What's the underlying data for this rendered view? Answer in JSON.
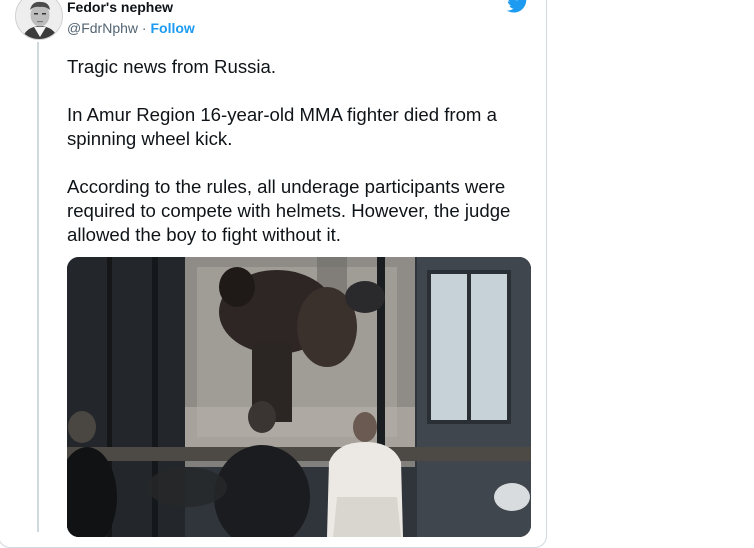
{
  "author": {
    "name": "Fedor's nephew",
    "handle": "@FdrNphw",
    "separator": " · ",
    "follow_label": "Follow"
  },
  "tweet": {
    "text": "Tragic news from Russia.\n\nIn Amur Region 16-year-old MMA fighter died from a spinning wheel kick.\n\nAccording to the rules, all underage participants were required to compete with helmets. However, the judge allowed the boy to fight without it."
  },
  "icons": {
    "platform": "twitter-bird-icon"
  },
  "colors": {
    "accent": "#1d9bf0",
    "text": "#0f1419",
    "secondary": "#536471",
    "border": "#cfd9de"
  }
}
